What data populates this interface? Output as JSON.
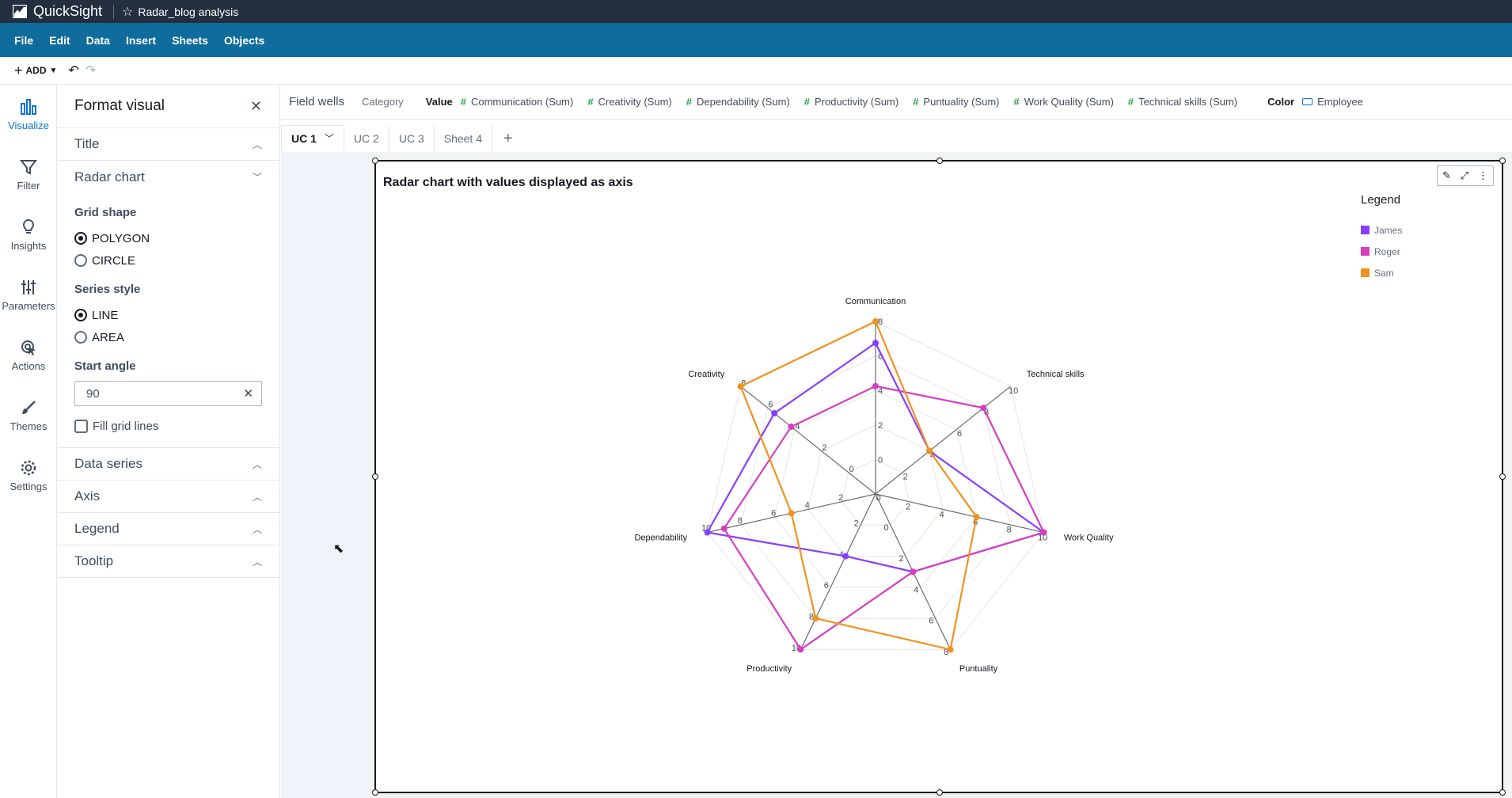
{
  "app": {
    "name": "QuickSight",
    "analysis_name": "Radar_blog analysis"
  },
  "menu": [
    "File",
    "Edit",
    "Data",
    "Insert",
    "Sheets",
    "Objects"
  ],
  "toolbar": {
    "add_label": "ADD"
  },
  "nav": [
    {
      "label": "Visualize",
      "icon": "bar-chart-icon",
      "active": true
    },
    {
      "label": "Filter",
      "icon": "filter-icon"
    },
    {
      "label": "Insights",
      "icon": "lightbulb-icon"
    },
    {
      "label": "Parameters",
      "icon": "sliders-icon"
    },
    {
      "label": "Actions",
      "icon": "pointer-icon"
    },
    {
      "label": "Themes",
      "icon": "brush-icon"
    },
    {
      "label": "Settings",
      "icon": "gear-icon"
    }
  ],
  "format_pane": {
    "title": "Format visual",
    "sections": {
      "title": "Title",
      "radar_chart": "Radar chart",
      "data_series": "Data series",
      "axis": "Axis",
      "legend": "Legend",
      "tooltip": "Tooltip"
    },
    "grid_shape": {
      "label": "Grid shape",
      "options": [
        "POLYGON",
        "CIRCLE"
      ],
      "selected": "POLYGON"
    },
    "series_style": {
      "label": "Series style",
      "options": [
        "LINE",
        "AREA"
      ],
      "selected": "LINE"
    },
    "start_angle": {
      "label": "Start angle",
      "value": "90"
    },
    "fill_grid_lines": {
      "label": "Fill grid lines",
      "checked": false
    }
  },
  "field_wells": {
    "title": "Field wells",
    "category_label": "Category",
    "value_label": "Value",
    "values": [
      "Communication (Sum)",
      "Creativity (Sum)",
      "Dependability (Sum)",
      "Productivity (Sum)",
      "Puntuality (Sum)",
      "Work Quality (Sum)",
      "Technical skills (Sum)"
    ],
    "color_label": "Color",
    "color_field": "Employee"
  },
  "sheets": [
    "UC 1",
    "UC 2",
    "UC 3",
    "Sheet 4"
  ],
  "chart_data": {
    "type": "radar",
    "title": "Radar chart with values displayed as axis",
    "legend_title": "Legend",
    "legend_position": "top-right",
    "grid_shape": "polygon",
    "axes": [
      {
        "name": "Communication",
        "ticks": [
          "0",
          "2",
          "4",
          "6",
          "8"
        ],
        "max": 8
      },
      {
        "name": "Technical skills",
        "ticks": [
          "0",
          "2",
          "4",
          "6",
          "8",
          "10"
        ],
        "max": 10
      },
      {
        "name": "Work Quality",
        "ticks": [
          "2",
          "4",
          "6",
          "8",
          "10"
        ],
        "max": 10
      },
      {
        "name": "Puntuality",
        "ticks": [
          "0",
          "2",
          "4",
          "6",
          "8"
        ],
        "max": 8
      },
      {
        "name": "Productivity",
        "ticks": [
          "2",
          "4",
          "6",
          "8",
          "10"
        ],
        "max": 10
      },
      {
        "name": "Dependability",
        "ticks": [
          "2",
          "4",
          "6",
          "8",
          "10"
        ],
        "max": 10
      },
      {
        "name": "Creativity",
        "ticks": [
          "0",
          "2",
          "4",
          "6",
          "8"
        ],
        "max": 8
      }
    ],
    "series": [
      {
        "name": "James",
        "color": "#8a3ffc",
        "values": [
          7,
          4,
          10,
          4,
          4,
          10,
          6
        ]
      },
      {
        "name": "Roger",
        "color": "#d63ebf",
        "values": [
          5,
          8,
          10,
          4,
          10,
          9,
          5
        ]
      },
      {
        "name": "Sam",
        "color": "#f0931e",
        "values": [
          8,
          4,
          6,
          8,
          8,
          5,
          8
        ]
      }
    ]
  }
}
